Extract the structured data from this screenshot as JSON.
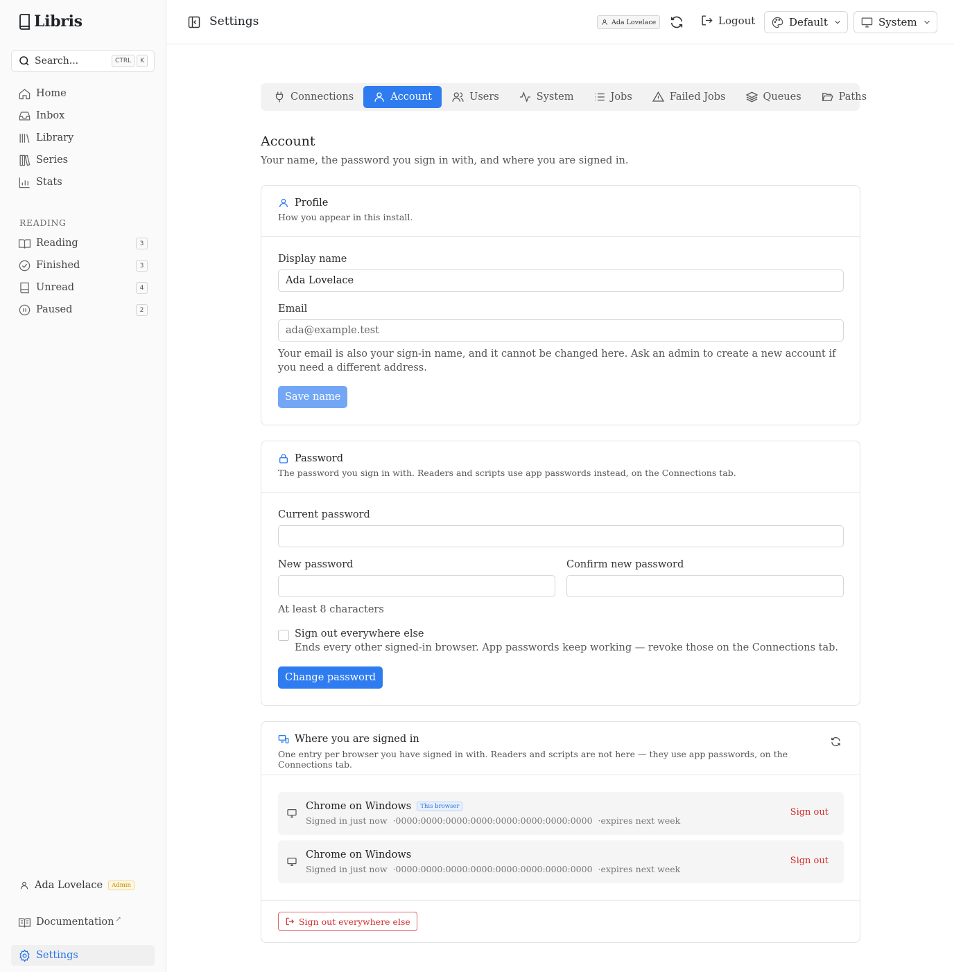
{
  "app": {
    "name": "Libris"
  },
  "search": {
    "label": "Search...",
    "kbd1": "CTRL",
    "kbd2": "K"
  },
  "sidebar": {
    "nav": [
      {
        "label": "Home",
        "icon": "home-icon"
      },
      {
        "label": "Inbox",
        "icon": "inbox-icon"
      },
      {
        "label": "Library",
        "icon": "library-icon"
      },
      {
        "label": "Series",
        "icon": "series-icon"
      },
      {
        "label": "Stats",
        "icon": "stats-icon"
      }
    ],
    "reading_section": "READING",
    "reading": [
      {
        "label": "Reading",
        "count": "3",
        "icon": "book-open-icon"
      },
      {
        "label": "Finished",
        "count": "3",
        "icon": "check-circle-icon"
      },
      {
        "label": "Unread",
        "count": "4",
        "icon": "book-icon"
      },
      {
        "label": "Paused",
        "count": "2",
        "icon": "pause-circle-icon"
      }
    ],
    "user_name": "Ada Lovelace",
    "user_badge": "Admin",
    "documentation": "Documentation",
    "documentation_suffix": "↗",
    "settings": "Settings"
  },
  "topbar": {
    "title": "Settings",
    "user_chip": "Ada Lovelace",
    "logout": "Logout",
    "theme": "Default",
    "mode": "System"
  },
  "tabs": [
    {
      "label": "Connections",
      "icon": "plug-icon",
      "active": false
    },
    {
      "label": "Account",
      "icon": "user-icon",
      "active": true
    },
    {
      "label": "Users",
      "icon": "users-icon",
      "active": false
    },
    {
      "label": "System",
      "icon": "activity-icon",
      "active": false
    },
    {
      "label": "Jobs",
      "icon": "list-icon",
      "active": false
    },
    {
      "label": "Failed Jobs",
      "icon": "alert-triangle-icon",
      "active": false
    },
    {
      "label": "Queues",
      "icon": "layers-icon",
      "active": false
    },
    {
      "label": "Paths",
      "icon": "folder-open-icon",
      "active": false
    }
  ],
  "page": {
    "title": "Account",
    "subtitle": "Your name, the password you sign in with, and where you are signed in."
  },
  "profile": {
    "title": "Profile",
    "description": "How you appear in this install.",
    "display_name_label": "Display name",
    "display_name_value": "Ada Lovelace",
    "email_label": "Email",
    "email_value": "ada@example.test",
    "email_help": "Your email is also your sign-in name, and it cannot be changed here. Ask an admin to create a new account if you need a different address.",
    "save_label": "Save name"
  },
  "password": {
    "title": "Password",
    "description": "The password you sign in with. Readers and scripts use app passwords instead, on the Connections tab.",
    "current_label": "Current password",
    "current_value": "",
    "new_label": "New password",
    "new_value": "",
    "confirm_label": "Confirm new password",
    "confirm_value": "",
    "hint": "At least 8 characters",
    "signout_label": "Sign out everywhere else",
    "signout_help": "Ends every other signed-in browser. App passwords keep working — revoke those on the Connections tab.",
    "signout_checked": false,
    "submit_label": "Change password"
  },
  "sessions": {
    "title": "Where you are signed in",
    "description": "One entry per browser you have signed in with. Readers and scripts are not here — they use app passwords, on the Connections tab.",
    "items": [
      {
        "name": "Chrome on Windows",
        "badge": "This browser",
        "signed_in": "Signed in just now",
        "address": "0000:0000:0000:0000:0000:0000:0000:0000",
        "expires": "expires next week",
        "action": "Sign out"
      },
      {
        "name": "Chrome on Windows",
        "badge": "",
        "signed_in": "Signed in just now",
        "address": "0000:0000:0000:0000:0000:0000:0000:0000",
        "expires": "expires next week",
        "action": "Sign out"
      }
    ],
    "signout_all_label": "Sign out everywhere else"
  },
  "colors": {
    "accent": "#2f7cf0",
    "danger": "#d12c2c",
    "admin_badge": "#b88200"
  }
}
